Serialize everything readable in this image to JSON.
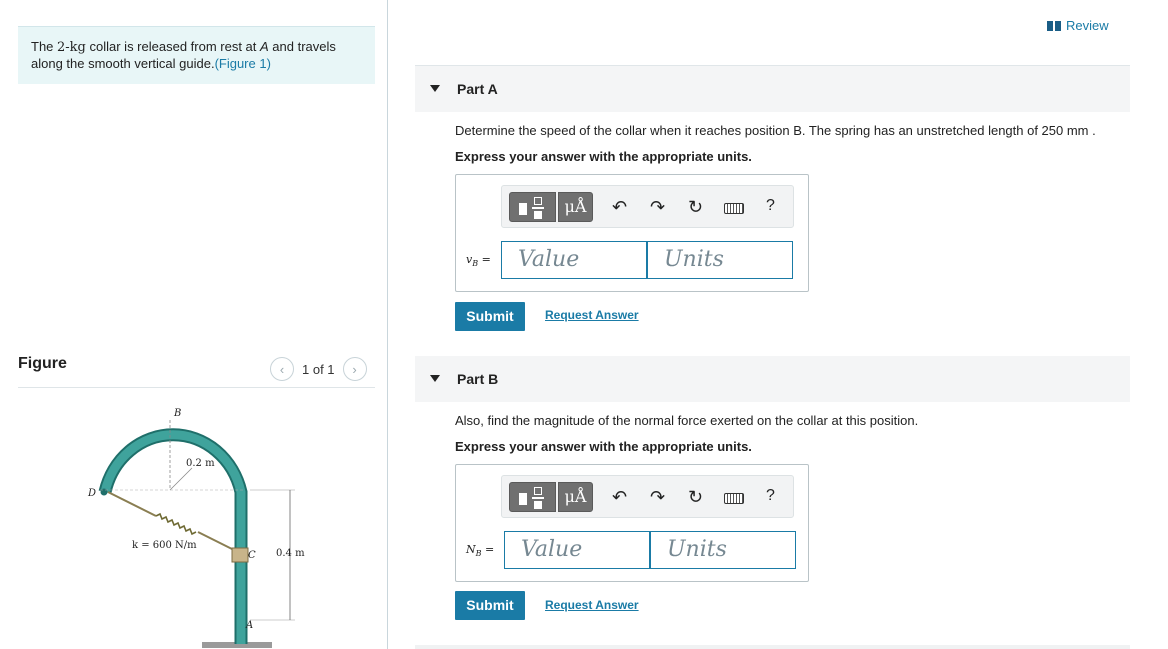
{
  "problem": {
    "text_pre": "The ",
    "mass": "2-kg",
    "text_post": " collar is released from rest at ",
    "point_a": "A",
    "text_end": " and travels along the smooth vertical guide.",
    "figure_link": "(Figure 1)"
  },
  "figure": {
    "title": "Figure",
    "count": "1 of 1",
    "labels": {
      "b": "B",
      "d": "D",
      "c": "C",
      "a": "A",
      "radius": "0.2 m",
      "spring": "k = 600 N/m",
      "height": "0.4 m"
    }
  },
  "review": {
    "label": "Review"
  },
  "parts": [
    {
      "label": "Part A",
      "question": "Determine the speed of the collar when it reaches position B. The spring has an unstretched length of 250 mm .",
      "instruction": "Express your answer with the appropriate units.",
      "var_main": "v",
      "var_sub": "B",
      "value_placeholder": "Value",
      "units_placeholder": "Units",
      "submit": "Submit",
      "request": "Request Answer"
    },
    {
      "label": "Part B",
      "question": "Also, find the magnitude of the normal force exerted on the collar at this position.",
      "instruction": "Express your answer with the appropriate units.",
      "var_main": "N",
      "var_sub": "B",
      "value_placeholder": "Value",
      "units_placeholder": "Units",
      "submit": "Submit",
      "request": "Request Answer"
    }
  ],
  "toolbar": {
    "mu_label": "μÅ",
    "help": "?",
    "icons": [
      "fraction-template-icon",
      "units-icon",
      "undo-icon",
      "redo-icon",
      "reset-icon",
      "keyboard-icon",
      "help-icon"
    ]
  },
  "colors": {
    "accent": "#1a7ba6",
    "problem_bg": "#e8f6f7",
    "guide": "#2f8f8a"
  }
}
